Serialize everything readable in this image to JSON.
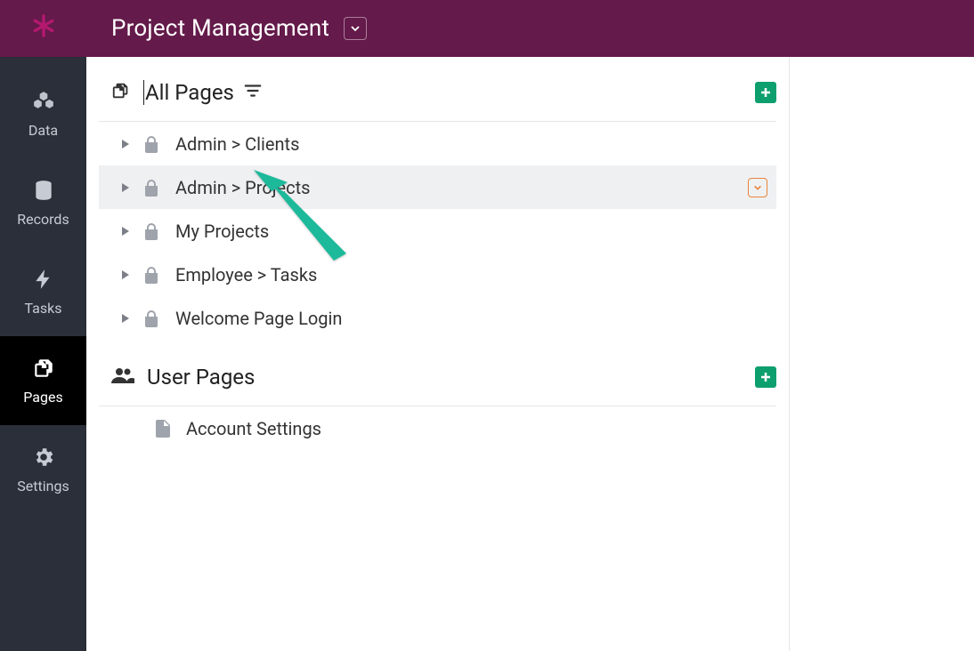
{
  "header": {
    "title": "Project Management"
  },
  "sidebar": {
    "items": [
      {
        "label": "Data",
        "icon": "cubes-icon",
        "active": false
      },
      {
        "label": "Records",
        "icon": "database-icon",
        "active": false
      },
      {
        "label": "Tasks",
        "icon": "bolt-icon",
        "active": false
      },
      {
        "label": "Pages",
        "icon": "pages-icon",
        "active": true
      },
      {
        "label": "Settings",
        "icon": "gear-icon",
        "active": false
      }
    ]
  },
  "sections": {
    "all_pages": {
      "title": "All Pages",
      "pages": [
        {
          "label": "Admin > Clients",
          "locked": true,
          "highlighted": false
        },
        {
          "label": "Admin > Projects",
          "locked": true,
          "highlighted": true,
          "has_dropdown": true
        },
        {
          "label": "My Projects",
          "locked": true,
          "highlighted": false,
          "partially_obscured": true
        },
        {
          "label": "Employee > Tasks",
          "locked": true,
          "highlighted": false
        },
        {
          "label": "Welcome Page Login",
          "locked": true,
          "highlighted": false
        }
      ]
    },
    "user_pages": {
      "title": "User Pages",
      "pages": [
        {
          "label": "Account Settings",
          "locked": false,
          "highlighted": false
        }
      ]
    }
  },
  "colors": {
    "header_bg": "#641a4a",
    "logo": "#b3186f",
    "sidebar_bg": "#2a2f39",
    "accent_green": "#0d9f6e",
    "annotation_arrow": "#1cb99a",
    "row_highlight": "#eff0f2",
    "dropdown_border_orange": "#e8853c"
  }
}
